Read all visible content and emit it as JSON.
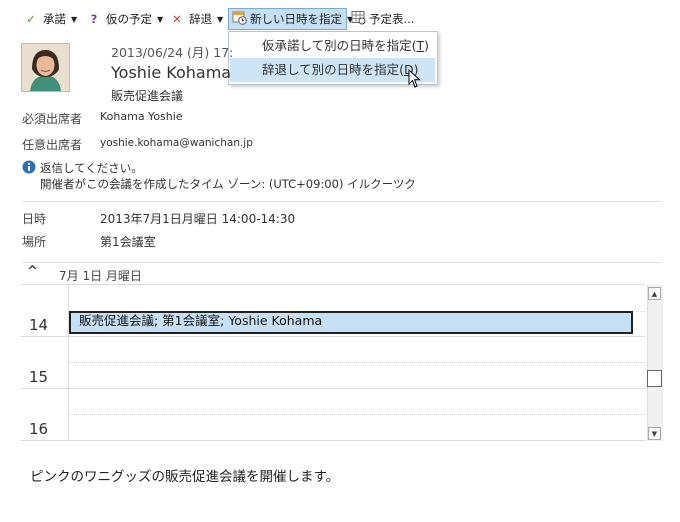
{
  "toolbar": {
    "accept": "承諾",
    "tentative": "仮の予定",
    "decline": "辞退",
    "propose_new_time": "新しい日時を指定",
    "calendar": "予定表..."
  },
  "dropdown": {
    "items": [
      {
        "label": "仮承諾して別の日時を指定(",
        "key": "T",
        "suffix": ")"
      },
      {
        "label": "辞退して別の日時を指定(",
        "key": "D",
        "suffix": ")"
      }
    ]
  },
  "header": {
    "sent": "2013/06/24 (月) 17:",
    "sender": "Yoshie Kohama",
    "subject": "販売促進会議"
  },
  "attendees": {
    "required_label": "必須出席者",
    "required_value": "Kohama Yoshie",
    "optional_label": "任意出席者",
    "optional_value": "yoshie.kohama@wanichan.jp"
  },
  "info": {
    "line1": "返信してください。",
    "line2": "開催者がこの会議を作成したタイム ゾーン: (UTC+09:00) イルクーツク"
  },
  "details": {
    "when_label": "日時",
    "when_value": "2013年7月1日月曜日 14:00-14:30",
    "where_label": "場所",
    "where_value": "第1会議室"
  },
  "calendar": {
    "collapse": "^",
    "day_header": "7月 1日 月曜日",
    "hours": [
      "14",
      "15",
      "16"
    ],
    "event": "販売促進会議; 第1会議室; Yoshie Kohama"
  },
  "message_body": "ピンクのワニグッズの販売促進会議を開催します。",
  "colors": {
    "accept_icon": "#4c9a3a",
    "tentative_icon": "#7b3fa0",
    "decline_icon": "#d13a2e",
    "highlight": "#c5dff5",
    "event_fill": "#c5e0f5"
  }
}
